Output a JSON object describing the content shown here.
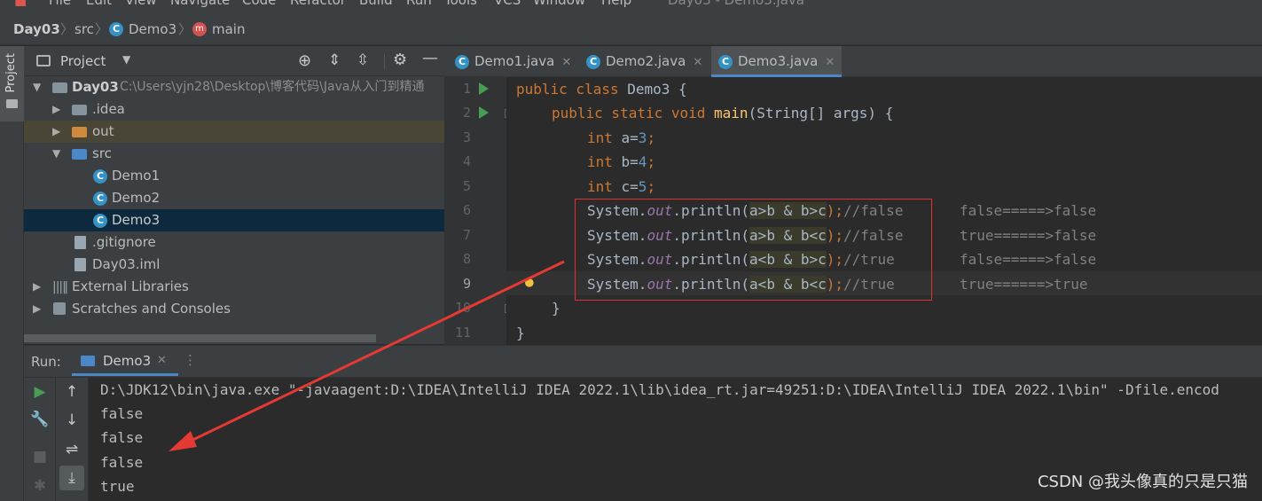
{
  "menu": [
    "File",
    "Edit",
    "View",
    "Navigate",
    "Code",
    "Refactor",
    "Build",
    "Run",
    "Tools",
    "VCS",
    "Window",
    "Help"
  ],
  "window_title": "Day03 - Demo3.java",
  "breadcrumb": {
    "project": "Day03",
    "folder": "src",
    "class": "Demo3",
    "method": "main"
  },
  "stripe": {
    "project_label": "Project"
  },
  "project_panel": {
    "title": "Project",
    "root": {
      "name": "Day03",
      "path": "C:\\Users\\yjn28\\Desktop\\博客代码\\Java从入门到精通"
    },
    "items": [
      ".idea",
      "out",
      "src",
      "Demo1",
      "Demo2",
      "Demo3",
      ".gitignore",
      "Day03.iml",
      "External Libraries",
      "Scratches and Consoles"
    ]
  },
  "tabs": [
    "Demo1.java",
    "Demo2.java",
    "Demo3.java"
  ],
  "active_tab": "Demo3.java",
  "editor": {
    "line_numbers": [
      "1",
      "2",
      "3",
      "4",
      "5",
      "6",
      "7",
      "8",
      "9",
      "10",
      "11"
    ],
    "lines": {
      "l1_kw": "public class ",
      "l1_name": "Demo3 {",
      "l2_kw": "public static void ",
      "l2_fn": "main",
      "l2_rest": "(String[] args) {",
      "l3_kw": "int ",
      "l3_var": "a=",
      "l3_num": "3",
      "l3_end": ";",
      "l4_kw": "int ",
      "l4_var": "b=",
      "l4_num": "4",
      "l4_end": ";",
      "l5_kw": "int ",
      "l5_var": "c=",
      "l5_num": "5",
      "l5_end": ";",
      "sys": "System.",
      "out": "out",
      "println": ".println(",
      "e6": "a>b & b>c",
      "e7": "a>b & b<c",
      "e8": "a<b & b>c",
      "e9": "a<b & b<c",
      "close": ");",
      "c6": "//false",
      "c7": "//false",
      "c8": "//true",
      "c9": "//true",
      "l10": "}",
      "l11": "}"
    },
    "annotations": [
      "false=====>false",
      "true======>false",
      "false=====>false",
      "true======>true"
    ]
  },
  "run_panel": {
    "label": "Run:",
    "tab": "Demo3",
    "command": "D:\\JDK12\\bin\\java.exe \"-javaagent:D:\\IDEA\\IntelliJ IDEA 2022.1\\lib\\idea_rt.jar=49251:D:\\IDEA\\IntelliJ IDEA 2022.1\\bin\" -Dfile.encod",
    "output": [
      "false",
      "false",
      "false",
      "true"
    ]
  },
  "watermark": "CSDN @我头像真的只是只猫",
  "colors": {
    "background": "#2b2b2b",
    "panel": "#3c3f41",
    "keyword": "#cc7832",
    "highlight_box": "#e03030",
    "arrow": "#e53935",
    "run_green": "#499c54"
  }
}
